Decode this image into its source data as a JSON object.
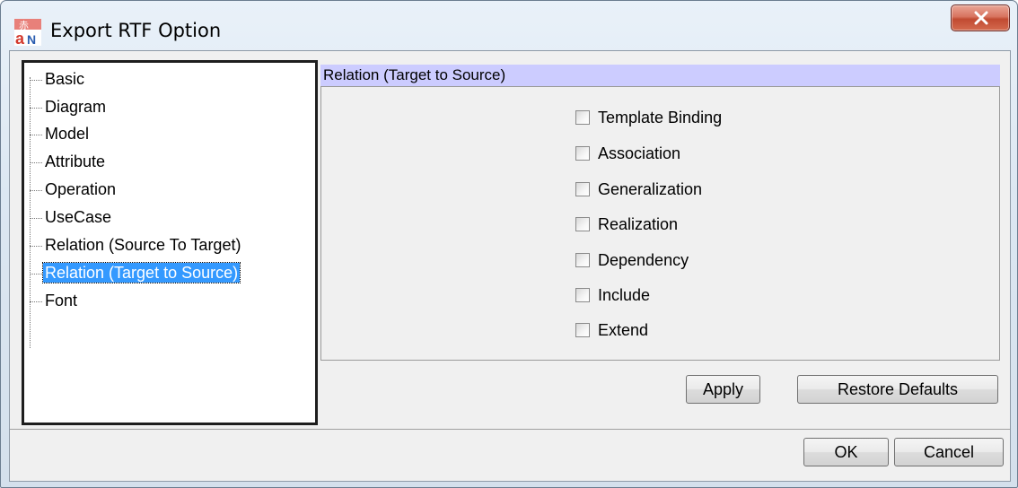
{
  "window": {
    "title": "Export RTF Option",
    "app_icon": "astah-app-icon",
    "close_icon": "close-icon"
  },
  "tree": {
    "items": [
      {
        "label": "Basic",
        "selected": false
      },
      {
        "label": "Diagram",
        "selected": false
      },
      {
        "label": "Model",
        "selected": false
      },
      {
        "label": "Attribute",
        "selected": false
      },
      {
        "label": "Operation",
        "selected": false
      },
      {
        "label": "UseCase",
        "selected": false
      },
      {
        "label": "Relation (Source To Target)",
        "selected": false
      },
      {
        "label": "Relation (Target to Source)",
        "selected": true
      },
      {
        "label": "Font",
        "selected": false
      }
    ]
  },
  "panel": {
    "header": "Relation (Target to Source)",
    "header_color": "#ccccff",
    "options": [
      {
        "label": "Template Binding",
        "checked": false
      },
      {
        "label": "Association",
        "checked": false
      },
      {
        "label": "Generalization",
        "checked": false
      },
      {
        "label": "Realization",
        "checked": false
      },
      {
        "label": "Dependency",
        "checked": false
      },
      {
        "label": "Include",
        "checked": false
      },
      {
        "label": "Extend",
        "checked": false
      }
    ],
    "apply_label": "Apply",
    "restore_label": "Restore Defaults"
  },
  "footer": {
    "ok_label": "OK",
    "cancel_label": "Cancel"
  },
  "colors": {
    "selection": "#3399ff",
    "close_button": "#c14a31"
  }
}
